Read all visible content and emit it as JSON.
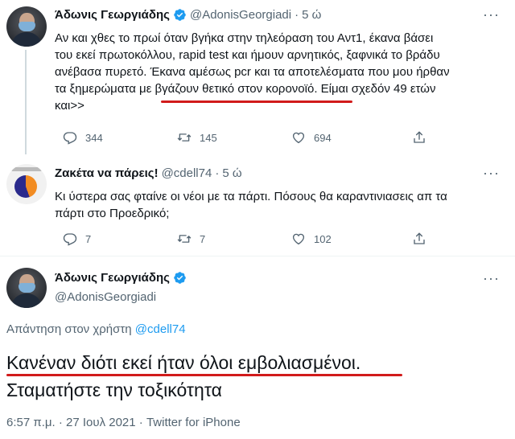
{
  "tweet1": {
    "display_name": "Άδωνις Γεωργιάδης",
    "handle": "@AdonisGeorgiadi",
    "separator": "·",
    "time": "5 ώ",
    "lines": [
      "Αν και χθες το πρωί όταν βγήκα στην τηλεόραση του Αντ1, έκανα βάσει",
      "του εκεί πρωτοκόλλου, rapid test και ήμουν αρνητικός, ξαφνικά το βράδυ",
      "ανέβασα πυρετό. Έκανα αμέσως pcr και τα αποτελέσματα που μου ήρθαν",
      "τα ξημερώματα με βγάζουν θετικό στον κορονοϊό. Είμαι σχεδόν 49 ετών",
      "και>>"
    ],
    "replies": "344",
    "retweets": "145",
    "likes": "694"
  },
  "tweet2": {
    "display_name": "Ζακέτα να πάρεις!",
    "handle": "@cdell74",
    "separator": "·",
    "time": "5 ώ",
    "lines": [
      "Κι ύστερα σας φταίνε οι νέοι με τα πάρτι. Πόσους θα καραντινιασεις απ τα",
      "πάρτι στο Προεδρικό;"
    ],
    "replies": "7",
    "retweets": "7",
    "likes": "102"
  },
  "tweet3": {
    "display_name": "Άδωνις Γεωργιάδης",
    "handle": "@AdonisGeorgiadi",
    "reply_prefix": "Απάντηση στον χρήστη",
    "reply_mention": "@cdell74",
    "lines": [
      "Κανέναν διότι εκεί ήταν όλοι εμβολιασμένοι.",
      "Σταματήστε την τοξικότητα"
    ],
    "footer": "6:57 π.μ. · 27 Ιουλ 2021 · Twitter for iPhone"
  },
  "colors": {
    "accent": "#1d9bf0",
    "secondary_text": "#536471",
    "highlight_underline": "#d11b1b"
  },
  "icons": [
    "more-icon",
    "verified-badge-icon",
    "reply-icon",
    "retweet-icon",
    "like-icon",
    "share-icon"
  ]
}
